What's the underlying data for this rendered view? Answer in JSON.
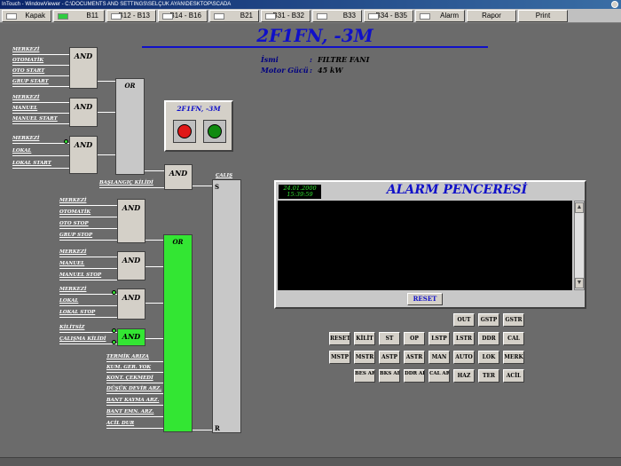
{
  "window": {
    "title": "InTouch - WindowViewer - C:\\DOCUMENTS AND SETTINGS\\SELÇUK AYAN\\DESKTOP\\SCADA"
  },
  "toolbar": {
    "kapak": "Kapak",
    "b11": "B11",
    "b12": "B12 - B13",
    "b14": "B14 - B16",
    "b21": "B21",
    "b31": "B31 - B32",
    "b33": "B33",
    "b34": "B34 - B35",
    "alarm": "Alarm",
    "rapor": "Rapor",
    "print": "Print"
  },
  "header": {
    "title": "2F1FN,  -3M",
    "name_label": "İsmi",
    "name_sep": ":",
    "name_value": "FILTRE FANI",
    "power_label": "Motor Gücü",
    "power_sep": ":",
    "power_value": "45 kW"
  },
  "motor_panel": {
    "title": "2F1FN,  -3M"
  },
  "logic": {
    "and_label": "AND",
    "or_label": "OR",
    "calis_label": "ÇALIŞ",
    "s_label": "S",
    "r_label": "R",
    "group1": [
      "MERKEZİ",
      "OTOMATİK",
      "OTO START",
      "GRUP START"
    ],
    "group2": [
      "MERKEZİ",
      "MANUEL",
      "MANUEL START"
    ],
    "group3": [
      "MERKEZİ",
      "LOKAL",
      "LOKAL START"
    ],
    "baslangic": "BAŞLANGIÇ KİLİDİ",
    "group4": [
      "MERKEZİ",
      "OTOMATİK",
      "OTO STOP",
      "GRUP STOP"
    ],
    "group5": [
      "MERKEZİ",
      "MANUEL",
      "MANUEL STOP"
    ],
    "group6": [
      "MERKEZİ",
      "LOKAL",
      "LOKAL STOP"
    ],
    "group7": [
      "KİLİTSİZ",
      "ÇALIŞMA KİLİDİ"
    ],
    "faults": [
      "TERMİK ARIZA",
      "KUM. GER. YOK",
      "KONT. ÇEKMEDİ",
      "DÜŞÜK DEVİR ARZ.",
      "BANT KAYMA ARZ.",
      "BANT EMN. ARZ.",
      "ACİL DUR"
    ]
  },
  "alarm": {
    "title": "ALARM PENCERESİ",
    "date": "24.01.2000",
    "time": "15:39:59",
    "reset": "RESET",
    "scroll_up": "▲",
    "scroll_down": "▼"
  },
  "keypad": {
    "row1": [
      "OUT",
      "GSTP",
      "GSTR"
    ],
    "row2": [
      "RESET",
      "KİLİT",
      "ST",
      "OP",
      "LSTP",
      "LSTR",
      "DDR",
      "CAL"
    ],
    "row3": [
      "MSTP",
      "MSTR",
      "ASTP",
      "ASTR",
      "MAN",
      "AUTO",
      "LOK",
      "MERK"
    ],
    "row4": [
      "BES ARZ",
      "BKS ARZ",
      "DDR ARZ",
      "CAL ARZ",
      "HAZ",
      "TER",
      "ACİL"
    ]
  },
  "colors": {
    "title_blue": "#1010c8",
    "signal_green": "#33e633",
    "panel_gray": "#6b6b6b"
  }
}
